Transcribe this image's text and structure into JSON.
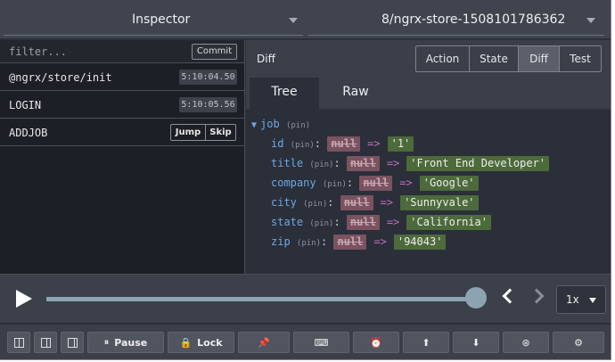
{
  "header": {
    "instance_select": "Inspector",
    "store_select": "8/ngrx-store-1508101786362"
  },
  "actions": {
    "filter_placeholder": "filter...",
    "commit_label": "Commit",
    "items": [
      {
        "name": "@ngrx/store/init",
        "time": "5:10:04.50"
      },
      {
        "name": "LOGIN",
        "time": "5:10:05.56"
      },
      {
        "name": "ADDJOB",
        "jump": "Jump",
        "skip": "Skip"
      }
    ]
  },
  "monitor": {
    "title": "Diff",
    "modes": [
      "Action",
      "State",
      "Diff",
      "Test"
    ],
    "selected_mode": "Diff",
    "tabs": [
      "Tree",
      "Raw"
    ],
    "selected_tab": "Tree",
    "root": {
      "key": "job",
      "pin": "(pin)"
    },
    "pin_label": "(pin)",
    "colon": ":",
    "arrow": "=>",
    "rows": [
      {
        "key": "id",
        "old": "null",
        "new": "'1'"
      },
      {
        "key": "title",
        "old": "null",
        "new": "'Front End Developer'"
      },
      {
        "key": "company",
        "old": "null",
        "new": "'Google'"
      },
      {
        "key": "city",
        "old": "null",
        "new": "'Sunnyvale'"
      },
      {
        "key": "state",
        "old": "null",
        "new": "'California'"
      },
      {
        "key": "zip",
        "old": "null",
        "new": "'94043'"
      }
    ]
  },
  "slider": {
    "position": 1.0,
    "speed": "1x"
  },
  "toolbar": {
    "pause_label": "Pause",
    "lock_label": "Lock"
  },
  "colors": {
    "background": "#2a2f3a",
    "accent": "#8ea3b2",
    "diff_removed": "#7a5260",
    "diff_added": "#4c6a3a",
    "key": "#6ea8e0"
  }
}
